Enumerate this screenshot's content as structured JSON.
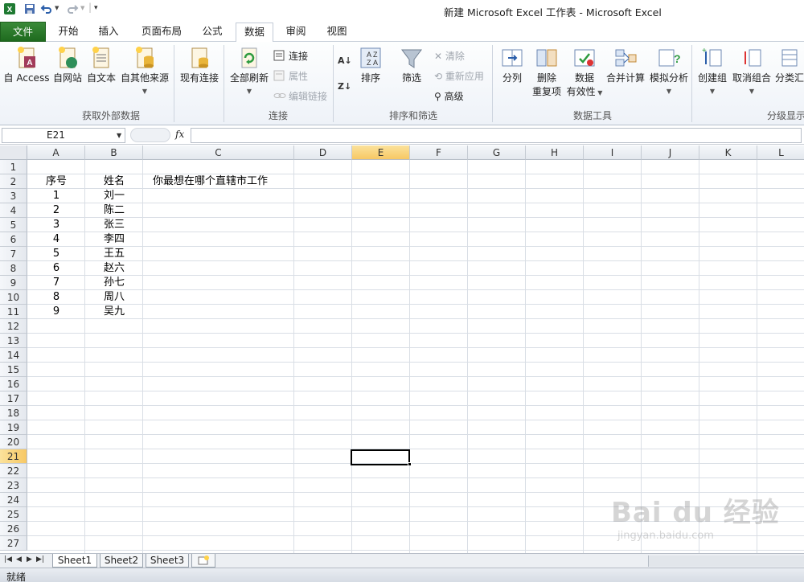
{
  "window": {
    "title": "新建 Microsoft Excel 工作表 - Microsoft Excel"
  },
  "quick_access": {
    "icons": [
      "excel-logo-icon",
      "save-icon",
      "undo-icon",
      "redo-icon",
      "customize-icon"
    ]
  },
  "tabs": [
    {
      "label": "文件"
    },
    {
      "label": "开始"
    },
    {
      "label": "插入"
    },
    {
      "label": "页面布局"
    },
    {
      "label": "公式"
    },
    {
      "label": "数据"
    },
    {
      "label": "审阅"
    },
    {
      "label": "视图"
    }
  ],
  "ribbon": {
    "external": {
      "label": "获取外部数据",
      "access": "自 Access",
      "web": "自网站",
      "text": "自文本",
      "other": "自其他来源",
      "existing": "现有连接"
    },
    "connections": {
      "label": "连接",
      "refresh_all": "全部刷新",
      "connections": "连接",
      "properties": "属性",
      "edit_links": "编辑链接"
    },
    "sort_filter": {
      "label": "排序和筛选",
      "sort": "排序",
      "filter": "筛选",
      "clear": "清除",
      "reapply": "重新应用",
      "advanced": "高级"
    },
    "data_tools": {
      "label": "数据工具",
      "text_to_columns": "分列",
      "remove_dup_1": "删除",
      "remove_dup_2": "重复项",
      "validation_1": "数据",
      "validation_2": "有效性",
      "consolidate": "合并计算",
      "what_if": "模拟分析"
    },
    "outline": {
      "label": "分级显示",
      "group": "创建组",
      "ungroup": "取消组合",
      "subtotal": "分类汇"
    }
  },
  "formula_bar": {
    "name_box": "E21",
    "fx": "fx",
    "formula": ""
  },
  "columns": [
    "A",
    "B",
    "C",
    "D",
    "E",
    "F",
    "G",
    "H",
    "I",
    "J",
    "K",
    "L"
  ],
  "rows": [
    "1",
    "2",
    "3",
    "4",
    "5",
    "6",
    "7",
    "8",
    "9",
    "10",
    "11",
    "12",
    "13",
    "14",
    "15",
    "16",
    "17",
    "18",
    "19",
    "20",
    "21",
    "22",
    "23",
    "24",
    "25",
    "26",
    "27"
  ],
  "cells": {
    "A2": "序号",
    "B2": "姓名",
    "C2": "你最想在哪个直辖市工作",
    "A3": "1",
    "B3": "刘一",
    "A4": "2",
    "B4": "陈二",
    "A5": "3",
    "B5": "张三",
    "A6": "4",
    "B6": "李四",
    "A7": "5",
    "B7": "王五",
    "A8": "6",
    "B8": "赵六",
    "A9": "7",
    "B9": "孙七",
    "A10": "8",
    "B10": "周八",
    "A11": "9",
    "B11": "吴九"
  },
  "active_cell": {
    "column": "E",
    "row": "21"
  },
  "sheets": [
    "Sheet1",
    "Sheet2",
    "Sheet3"
  ],
  "active_sheet": "Sheet1",
  "status": "就绪",
  "watermark": {
    "brand": "Bai du 经验",
    "url": "jingyan.baidu.com"
  }
}
